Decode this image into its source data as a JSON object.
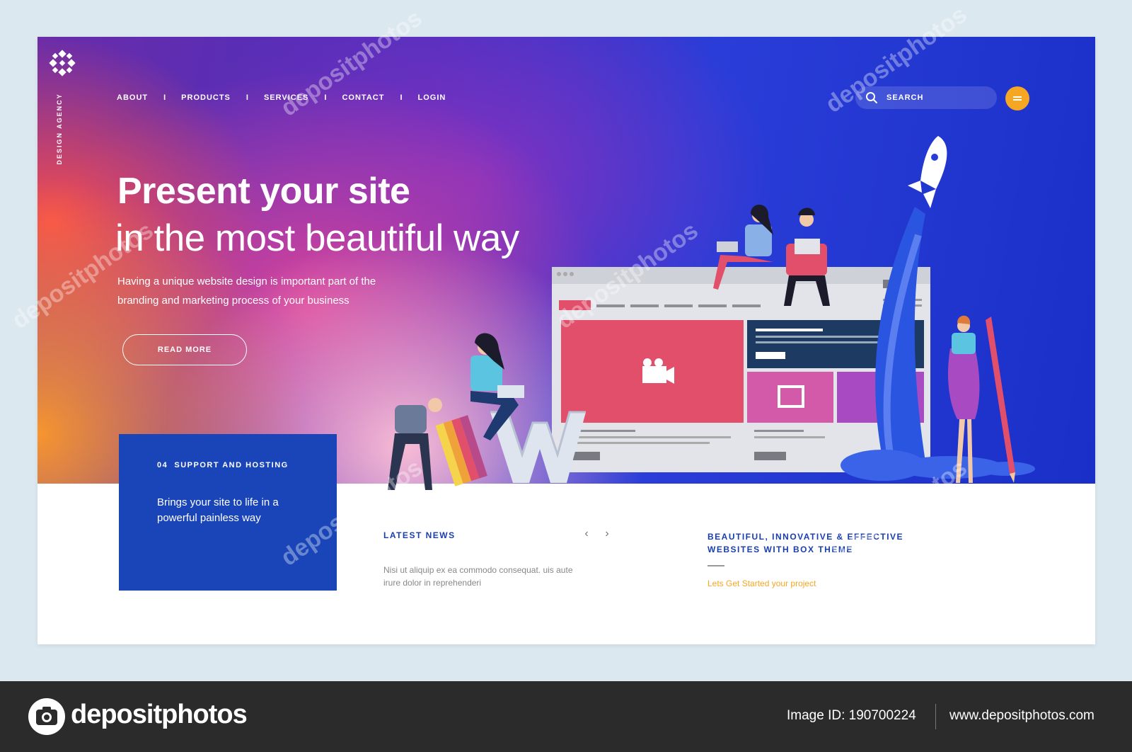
{
  "brand": {
    "tagline": "DESIGN AGENCY"
  },
  "nav": {
    "items": [
      "ABOUT",
      "PRODUCTS",
      "SERVICES",
      "CONTACT",
      "LOGIN"
    ],
    "separator": "I"
  },
  "search": {
    "placeholder": "SEARCH"
  },
  "hero": {
    "title": "Present your site",
    "subtitle": "in the most beautiful way",
    "description": "Having a unique website design is important part of the branding and marketing process of your business",
    "cta": "READ MORE"
  },
  "support": {
    "number": "04",
    "title": "SUPPORT AND HOSTING",
    "text": "Brings your site to life in a powerful painless way"
  },
  "news": {
    "title": "LATEST NEWS",
    "prev": "‹",
    "next": "›",
    "text": "Nisi ut aliquip ex ea commodo consequat. uis aute irure dolor in reprehenderi"
  },
  "promo": {
    "title": "BEAUTIFUL, INNOVATIVE & EFFECTIVE WEBSITES WITH BOX THEME",
    "link": "Lets Get Started your project"
  },
  "footer": {
    "site_name": "depositphotos",
    "image_id": "Image ID: 190700224",
    "website": "www.depositphotos.com"
  },
  "watermark": "depositphotos",
  "colors": {
    "accent_orange": "#f5a623",
    "support_blue": "#1a45b8",
    "heading_blue": "#1a3eb0",
    "footer_bg": "#2b2b2b"
  }
}
